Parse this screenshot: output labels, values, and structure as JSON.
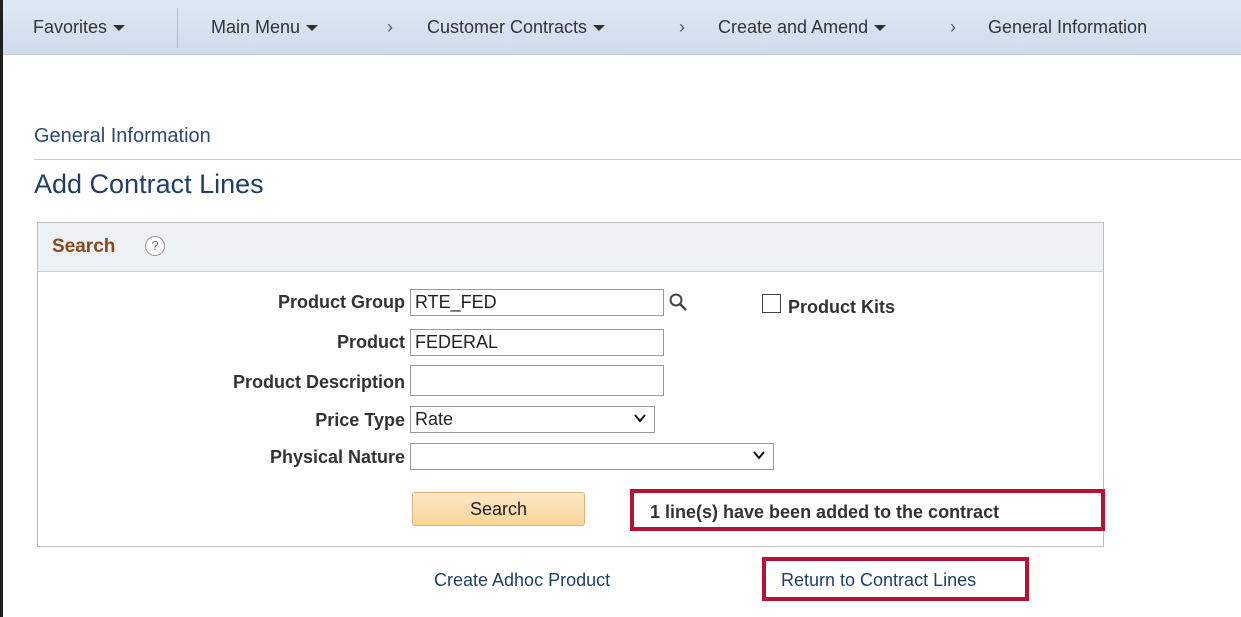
{
  "nav": {
    "favorites": "Favorites",
    "main_menu": "Main Menu",
    "customer_contracts": "Customer Contracts",
    "create_and_amend": "Create and Amend",
    "general_information": "General Information",
    "separator": "›"
  },
  "page": {
    "subtitle": "General Information",
    "title": "Add Contract Lines"
  },
  "search_box": {
    "header": "Search",
    "help": "?",
    "product_group_label": "Product Group",
    "product_group_value": "RTE_FED",
    "product_kits_label": "Product Kits",
    "product_kits_checked": false,
    "product_label": "Product",
    "product_value": "FEDERAL",
    "product_description_label": "Product Description",
    "product_description_value": "",
    "price_type_label": "Price Type",
    "price_type_value": "Rate",
    "physical_nature_label": "Physical Nature",
    "physical_nature_value": "",
    "search_button": "Search",
    "message": "1 line(s) have been added to the contract"
  },
  "links": {
    "create_adhoc": "Create Adhoc Product",
    "return_to_lines": "Return to Contract Lines"
  },
  "colors": {
    "nav_bg": "#d6e2f0",
    "title": "#1f3f6b",
    "search_header": "#8b4a1e",
    "highlight": "#b5132f",
    "button": "#f9d49a"
  }
}
